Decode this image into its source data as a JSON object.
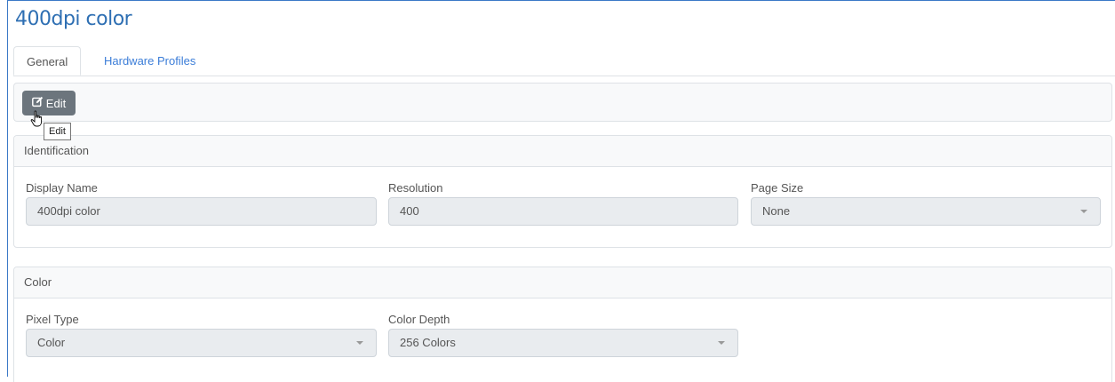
{
  "page": {
    "title": "400dpi color"
  },
  "tabs": [
    {
      "label": "General"
    },
    {
      "label": "Hardware Profiles"
    }
  ],
  "toolbar": {
    "edit_label": "Edit",
    "edit_tooltip": "Edit",
    "edit_icon": "edit-icon"
  },
  "identification": {
    "title": "Identification",
    "display_name": {
      "label": "Display Name",
      "value": "400dpi color"
    },
    "resolution": {
      "label": "Resolution",
      "value": "400"
    },
    "page_size": {
      "label": "Page Size",
      "value": "None"
    }
  },
  "color": {
    "title": "Color",
    "pixel_type": {
      "label": "Pixel Type",
      "value": "Color"
    },
    "color_depth": {
      "label": "Color Depth",
      "value": "256 Colors"
    }
  },
  "colors": {
    "accent": "#3b7dd8",
    "title": "#2e6fb3",
    "button": "#6c757d"
  }
}
